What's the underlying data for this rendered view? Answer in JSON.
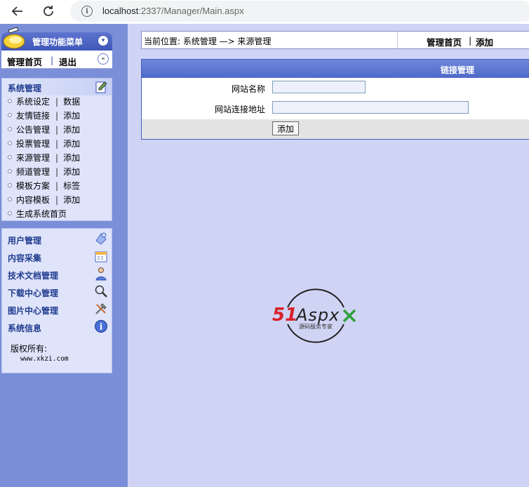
{
  "browser": {
    "url_host": "localhost",
    "url_rest": ":2337/Manager/Main.aspx"
  },
  "sidebar": {
    "menu_title": "管理功能菜单",
    "top_links": {
      "home": "管理首页",
      "divider": "|",
      "logout": "退出"
    },
    "system_section": {
      "title": "系统管理",
      "items": [
        {
          "label": "系统设定",
          "action": "数据"
        },
        {
          "label": "友情链接",
          "action": "添加"
        },
        {
          "label": "公告管理",
          "action": "添加"
        },
        {
          "label": "投票管理",
          "action": "添加"
        },
        {
          "label": "来源管理",
          "action": "添加"
        },
        {
          "label": "频道管理",
          "action": "添加"
        },
        {
          "label": "模板方案",
          "action": "标签"
        },
        {
          "label": "内容模板",
          "action": "添加"
        },
        {
          "label": "生成系统首页",
          "action": ""
        }
      ],
      "separator": "|"
    },
    "categories": [
      {
        "label": "用户管理",
        "icon": "users-icon"
      },
      {
        "label": "内容采集",
        "icon": "calendar-icon"
      },
      {
        "label": "技术文档管理",
        "icon": "person-icon"
      },
      {
        "label": "下载中心管理",
        "icon": "magnifier-icon"
      },
      {
        "label": "图片中心管理",
        "icon": "tools-icon"
      },
      {
        "label": "系统信息",
        "icon": "info-icon"
      }
    ],
    "copyright_label": "版权所有:",
    "copyright_url": "www.xkzi.com"
  },
  "breadcrumb": {
    "text": "当前位置: 系统管理 —> 来源管理",
    "home_link": "管理首页",
    "divider": "|",
    "add_link": "添加"
  },
  "form": {
    "header": "链接管理",
    "fields": [
      {
        "label": "网站名称",
        "value": ""
      },
      {
        "label": "网站连接地址",
        "value": ""
      }
    ],
    "submit_label": "添加"
  },
  "watermark": {
    "brand_51": "51",
    "brand_aspx": "Aspx",
    "tagline": "源码服务专家"
  },
  "colors": {
    "sidebar_bg": "#7b8fd8",
    "content_bg": "#d0d4f4",
    "header_blue": "#4e69c8",
    "section_text": "#1e3b8e"
  }
}
